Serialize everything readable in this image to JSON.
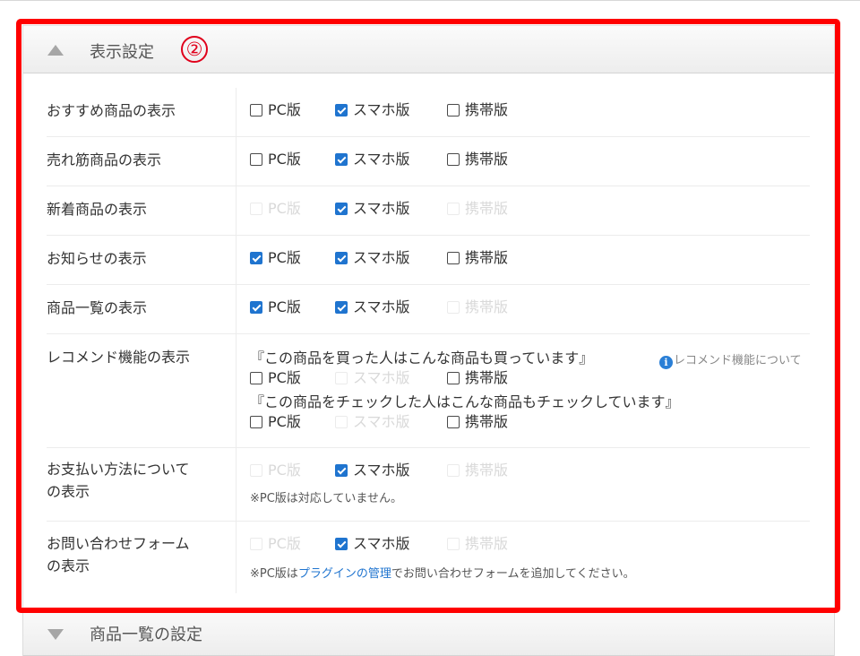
{
  "badge": "②",
  "sections": [
    {
      "title": "表示設定",
      "state": "expanded"
    },
    {
      "title": "商品一覧の設定",
      "state": "collapsed"
    }
  ],
  "labels": {
    "pc": "PC版",
    "smartphone": "スマホ版",
    "mobile": "携帯版"
  },
  "rows": {
    "recommended": {
      "label": "おすすめ商品の表示"
    },
    "bestseller": {
      "label": "売れ筋商品の表示"
    },
    "new_items": {
      "label": "新着商品の表示"
    },
    "news": {
      "label": "お知らせの表示"
    },
    "product_list": {
      "label": "商品一覧の表示"
    },
    "recommend": {
      "label": "レコメンド機能の表示",
      "line1": "『この商品を買った人はこんな商品も買っています』",
      "line2": "『この商品をチェックした人はこんな商品もチェックしています』",
      "info_link": "レコメンド機能について"
    },
    "payment": {
      "label_l1": "お支払い方法について",
      "label_l2": "の表示",
      "note": "※PC版は対応していません。"
    },
    "contact": {
      "label_l1": "お問い合わせフォーム",
      "label_l2": "の表示",
      "note_pre": "※PC版は",
      "note_link": "プラグインの管理",
      "note_post": "でお問い合わせフォームを追加してください。"
    }
  }
}
